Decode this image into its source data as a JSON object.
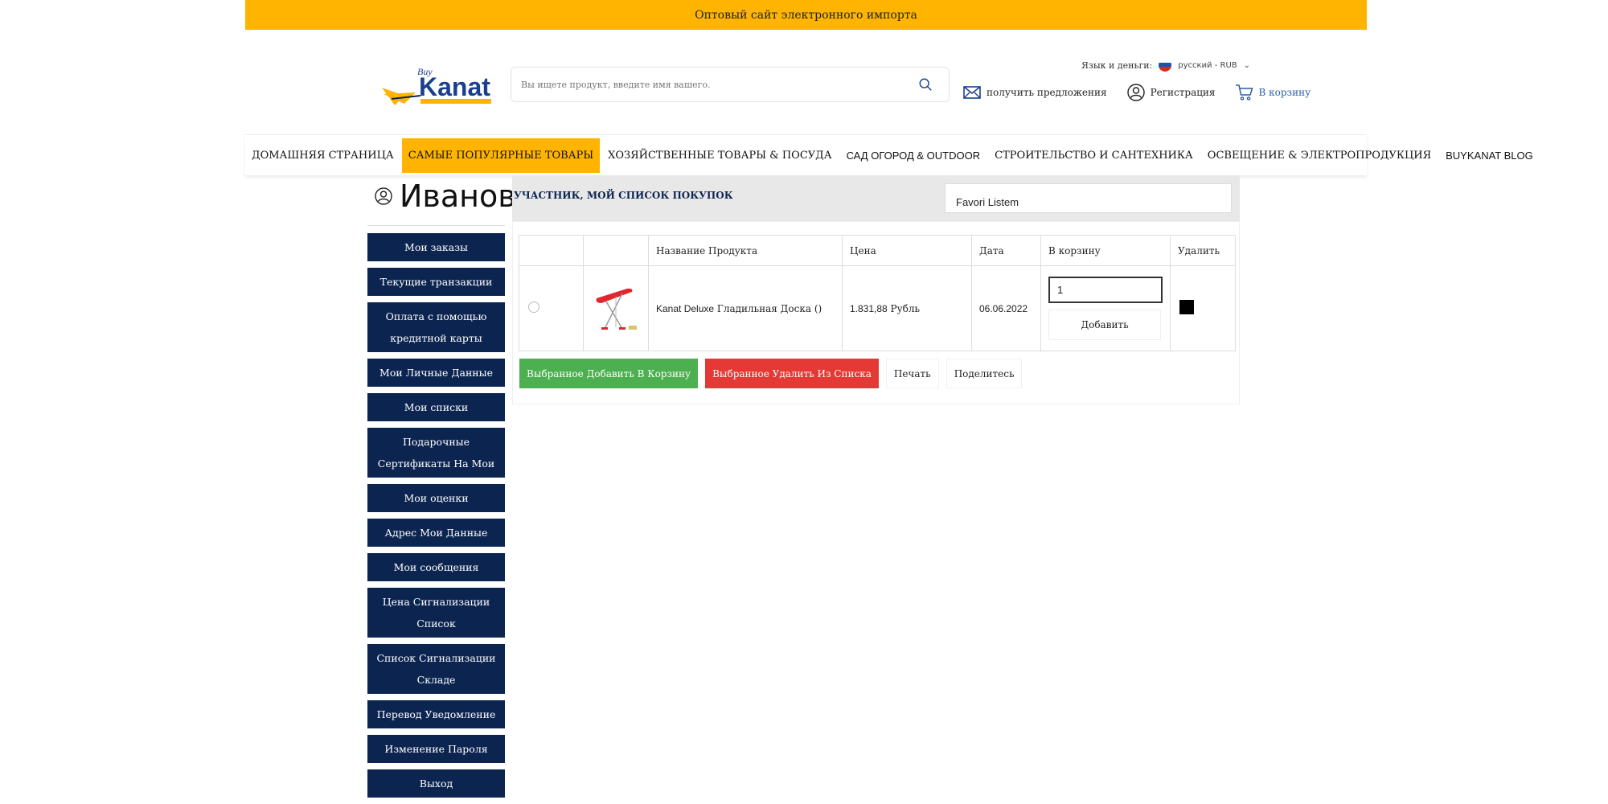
{
  "banner": {
    "text": "Оптовый сайт электронного импорта"
  },
  "header": {
    "logo_text": "Kanat",
    "logo_small": "Buy",
    "search_placeholder": "Вы ищете продукт, введите имя вашего.",
    "lang_label": "Язык и деньги:",
    "lang_value": "русский - RUB",
    "actions": {
      "offers": "получить предложения",
      "register": "Регистрация",
      "cart": "В корзину"
    }
  },
  "nav": {
    "items": [
      "ДОМАШНЯЯ СТРАНИЦА",
      "САМЫЕ ПОПУЛЯРНЫЕ ТОВАРЫ",
      "ХОЗЯЙСТВЕННЫЕ ТОВАРЫ & ПОСУДА",
      "САД ОГОРОД & OUTDOOR",
      "СТРОИТЕЛЬСТВО И САНТЕХНИКА",
      "ОСВЕЩЕНИЕ & ЭЛЕКТРОПРОДУКЦИЯ",
      "BUYKANAT BLOG"
    ],
    "active_index": 1
  },
  "user": {
    "name": "Иванов"
  },
  "sidebar": {
    "items": [
      "Мои заказы",
      "Текущие транзакции",
      "Оплата с помощью кредитной карты",
      "Мои Личные Данные",
      "Мои списки",
      "Подарочные Сертификаты На Мои",
      "Мои оценки",
      "Адрес Мои Данные",
      "Мои сообщения",
      "Цена Сигнализации Список",
      "Список Сигнализации Складе",
      "Перевод Уведомление",
      "Изменение Пароля",
      "Выход"
    ]
  },
  "panel": {
    "title": "УЧАСТНИК, МОЙ СПИСОК ПОКУПОК",
    "list_select_value": "Favori Listem"
  },
  "table": {
    "headers": [
      "",
      "",
      "Название Продукта",
      "Цена",
      "Дата",
      "В корзину",
      "Удалить"
    ],
    "rows": [
      {
        "brand": "Kanat Deluxe",
        "name": "Гладильная Доска ()",
        "price": "1.831,88",
        "currency": "Рубль",
        "date": "06.06.2022",
        "qty": "1",
        "add_label": "Добавить"
      }
    ]
  },
  "actions": {
    "add_selected": "Выбранное Добавить В Корзину",
    "remove_selected": "Выбранное Удалить Из Списка",
    "print": "Печать",
    "share": "Поделитесь"
  },
  "colors": {
    "accent": "#feb400",
    "navy": "#0c2550",
    "green": "#4caf50",
    "red": "#e53935"
  }
}
